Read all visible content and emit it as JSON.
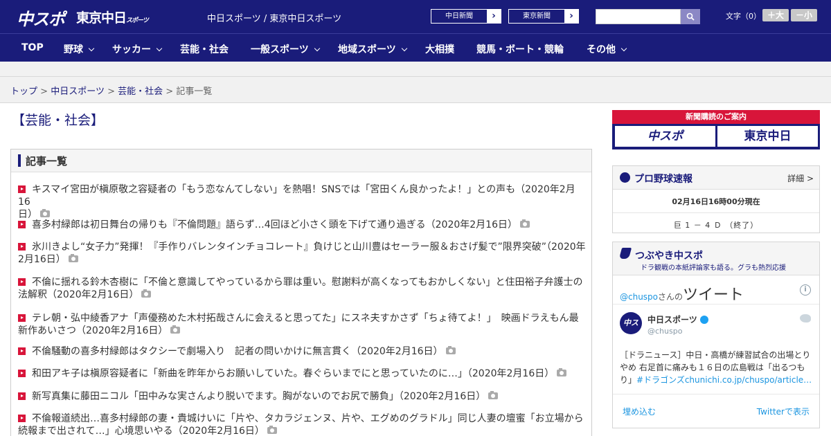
{
  "header": {
    "logo_main": "中スポ",
    "logo_sub": "東京中日",
    "logo_sub_small": "スポーツ",
    "site_names": "中日スポーツ / 東京中日スポーツ",
    "ext_links": [
      {
        "label": "中日新聞"
      },
      {
        "label": "東京新聞"
      }
    ],
    "search_placeholder": "",
    "fontsize_label": "文字（0）",
    "fontsize_larger": "＋大",
    "fontsize_smaller": "－小",
    "accent_color": "#1a1c7a"
  },
  "nav": {
    "items": [
      {
        "label": "TOP",
        "has_dropdown": false
      },
      {
        "label": "野球",
        "has_dropdown": true
      },
      {
        "label": "サッカー",
        "has_dropdown": true
      },
      {
        "label": "芸能・社会",
        "has_dropdown": false
      },
      {
        "label": "一般スポーツ",
        "has_dropdown": true
      },
      {
        "label": "地域スポーツ",
        "has_dropdown": true
      },
      {
        "label": "大相撲",
        "has_dropdown": false
      },
      {
        "label": "競馬・ボート・競輪",
        "has_dropdown": false
      },
      {
        "label": "その他",
        "has_dropdown": true
      }
    ]
  },
  "breadcrumb": {
    "items": [
      "トップ",
      "中日スポーツ",
      "芸能・社会"
    ],
    "current": "記事一覧",
    "separator": ">"
  },
  "section_title": "【芸能・社会】",
  "article_list": {
    "heading": "記事一覧",
    "bullet_color": "#d8153a",
    "items": [
      {
        "line1": "キスマイ宮田が槇原敬之容疑者の「もう恋なんてしない」を熱唱！SNSでは「宮田くん良かったよ！」との声も（2020年2月16",
        "line2": "日）",
        "photo": true
      },
      {
        "line1": "喜多村緑郎は初日舞台の帰りも『不倫問題』語らず…4回ほど小さく頭を下げて通り過ぎる（2020年2月16日）",
        "line2": "",
        "photo": true
      },
      {
        "line1": "氷川きよし“女子力”発揮！『手作りバレンタインチョコレート』負けじと山川豊はセーラー服＆おさげ髪で”限界突破”（2020年",
        "line2": "2月16日）",
        "photo": true
      },
      {
        "line1": "不倫に揺れる鈴木杏樹に「不倫と意識してやっているから罪は重い。慰謝料が高くなってもおかしくない」と住田裕子弁護士の",
        "line2": "法解釈（2020年2月16日）",
        "photo": true
      },
      {
        "line1": "テレ朝・弘中綾香アナ「声優務めた木村拓哉さんに会えると思ってた」にスネ夫すかさず「ちょ待てよ！」　映画ドラえもん最",
        "line2": "新作あいさつ（2020年2月16日）",
        "photo": true
      },
      {
        "line1": "不倫騒動の喜多村緑郎はタクシーで劇場入り　記者の問いかけに無言貫く（2020年2月16日）",
        "line2": "",
        "photo": true
      },
      {
        "line1": "和田アキ子は槇原容疑者に「新曲を昨年からお願いしていた。春ぐらいまでにと思っていたのに…」（2020年2月16日）",
        "line2": "",
        "photo": true
      },
      {
        "line1": "新写真集に藤田ニコル「田中みな実さんより脱いでます。胸がないのでお尻で勝負」（2020年2月16日）",
        "line2": "",
        "photo": true
      },
      {
        "line1": "不倫報道続出…喜多村緑郎の妻・貴城けいに「片や、タカラジェンヌ、片や、エグめのグラドル」同じ人妻の壇蜜「お立場から",
        "line2": "続報まで出されて…」心境思いやる（2020年2月16日）",
        "photo": true
      }
    ]
  },
  "sidebar": {
    "subscription": {
      "title": "新聞購読のご案内",
      "logo_left": "中スポ",
      "logo_right": "東京中日"
    },
    "baseball": {
      "title": "プロ野球速報",
      "more": "詳細 >",
      "time": "02月16日16時00分現在",
      "score": "巨 1 － 4 Ｄ （終了）"
    },
    "tweets": {
      "title": "つぶやき中スポ",
      "subtitle": "ドラ観戦の本紙評論家も語る。グラも熱烈応援",
      "handle_prefix": "@chuspo",
      "handle_suffix": "さんの",
      "label": "ツイート",
      "info": "i",
      "account_name": "中日スポーツ",
      "account_handle": "@chuspo",
      "avatar_text": "中スポ",
      "tweet_text": "［ドラニュース］中日・高橋が練習試合の出場とりやめ 右足首に痛みも１６日の広島戦は「出るつもり」",
      "tweet_link": "#ドラゴンズchunichi.co.jp/chuspo/article…",
      "embed": "埋め込む",
      "view_on_twitter": "Twitterで表示"
    }
  }
}
